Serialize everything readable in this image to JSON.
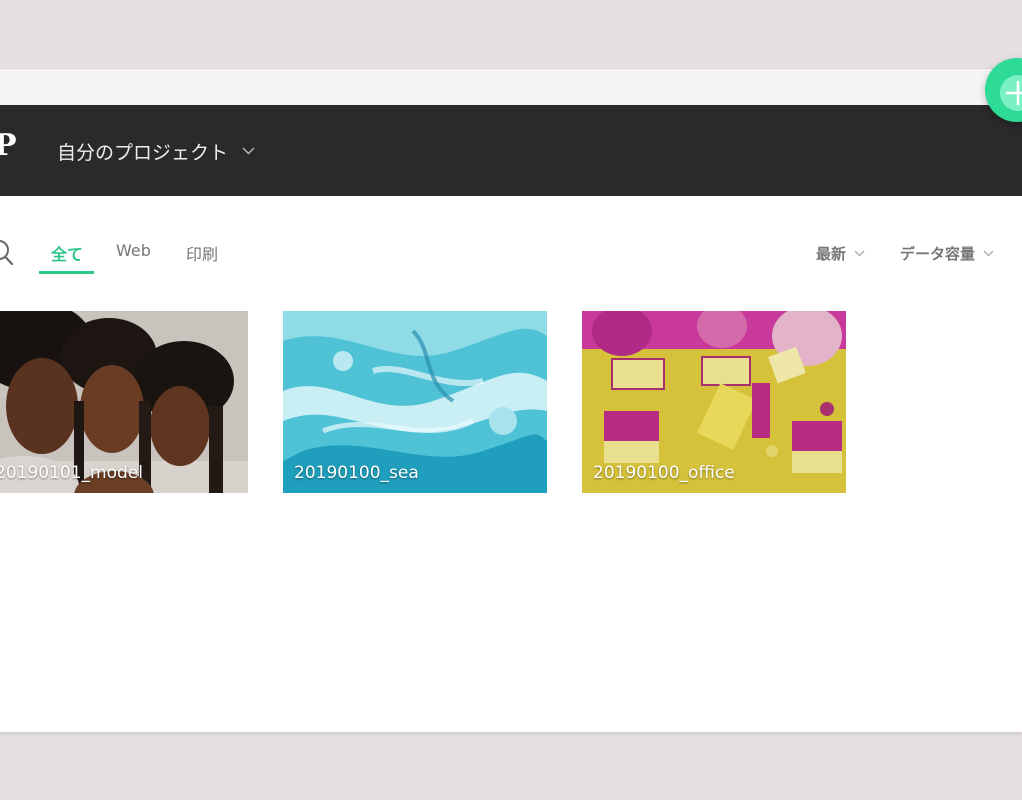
{
  "header": {
    "logo_text": "P",
    "project_selector_label": "自分のプロジェクト"
  },
  "filter_tabs": [
    {
      "label": "全て",
      "active": true
    },
    {
      "label": "Web",
      "active": false
    },
    {
      "label": "印刷",
      "active": false
    }
  ],
  "sort": {
    "order_label": "最新",
    "capacity_label": "データ容量"
  },
  "projects": [
    {
      "name": "20190101_model",
      "thumbnail": "portrait-photo"
    },
    {
      "name": "20190100_sea",
      "thumbnail": "marble-sea-photo"
    },
    {
      "name": "20190100_office",
      "thumbnail": "office-desk-photo"
    }
  ],
  "colors": {
    "accent": "#2cc787",
    "header_bg": "#2a2a2a",
    "fab": "#2edb96"
  }
}
